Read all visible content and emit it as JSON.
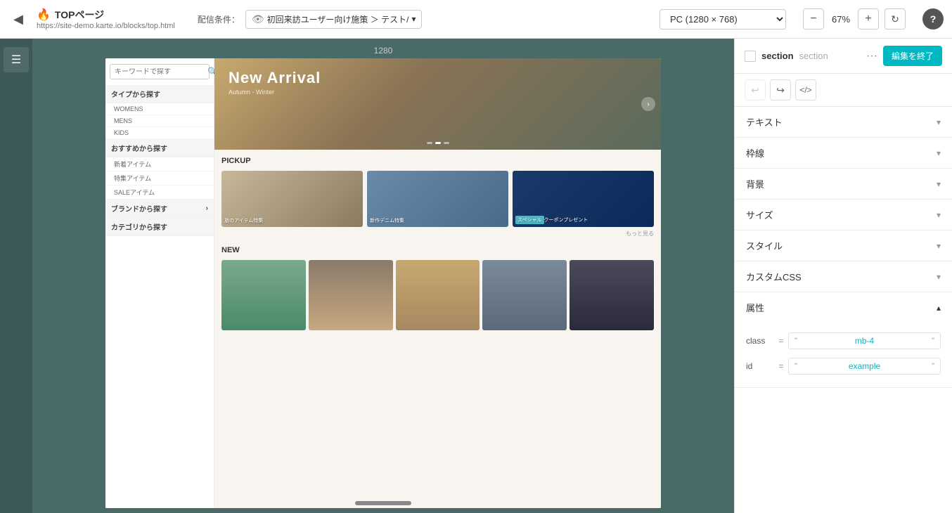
{
  "topbar": {
    "back_icon": "◀",
    "page_emoji": "🔥",
    "page_title": "TOPページ",
    "page_url": "https://site-demo.karte.io/blocks/top.html",
    "condition_label": "配信条件：",
    "condition_value": "初回来訪ユーザー向け施策 ＞ テスト/",
    "condition_chevron": "▾",
    "device_label": "PC (1280 × 768)",
    "zoom_minus": "−",
    "zoom_value": "67%",
    "zoom_plus": "+",
    "refresh_icon": "↻",
    "help_icon": "?"
  },
  "panel": {
    "checkbox_checked": false,
    "type_label": "section",
    "sub_label": "section",
    "more_icon": "···",
    "finish_button": "編集を終了",
    "undo_icon": "↩",
    "redo_icon": "↪",
    "code_icon": "</>",
    "sections": [
      {
        "key": "text",
        "label": "テキスト"
      },
      {
        "key": "border",
        "label": "枠線"
      },
      {
        "key": "background",
        "label": "背景"
      },
      {
        "key": "size",
        "label": "サイズ"
      },
      {
        "key": "style",
        "label": "スタイル"
      },
      {
        "key": "custom_css",
        "label": "カスタムCSS"
      }
    ],
    "attributes_label": "属性",
    "attributes": [
      {
        "key": "class",
        "equals": "=",
        "quote_open": "\"",
        "value": "mb-4",
        "quote_close": "\""
      },
      {
        "key": "id",
        "equals": "=",
        "quote_open": "\"",
        "value": "example",
        "quote_close": "\""
      }
    ]
  },
  "preview": {
    "width_label": "1280",
    "sidebar": {
      "search_placeholder": "キーワードで探す",
      "nav_items": [
        {
          "label": "タイプから探す",
          "type": "section"
        },
        {
          "label": "WOMENS",
          "type": "sub"
        },
        {
          "label": "MENS",
          "type": "sub"
        },
        {
          "label": "KIDS",
          "type": "sub"
        },
        {
          "label": "おすすめから探す",
          "type": "section"
        },
        {
          "label": "新着アイテム",
          "type": "sub"
        },
        {
          "label": "特集アイテム",
          "type": "sub"
        },
        {
          "label": "SALEアイテム",
          "type": "sub"
        },
        {
          "label": "ブランドから探す ›",
          "type": "section"
        },
        {
          "label": "カテゴリから探す",
          "type": "section"
        }
      ]
    },
    "hero": {
      "title": "New Arrival",
      "subtitle": "Autumn - Winter"
    },
    "pickup": {
      "section_title": "PICKUP",
      "items": [
        {
          "label": "旅のアイテム特集"
        },
        {
          "label": "新作デニム特集"
        },
        {
          "label": "スペシャルクーポンプレゼント",
          "badge": "スペシャル"
        }
      ],
      "more_text": "もっと見る"
    },
    "new_section": {
      "title": "NEW"
    }
  }
}
